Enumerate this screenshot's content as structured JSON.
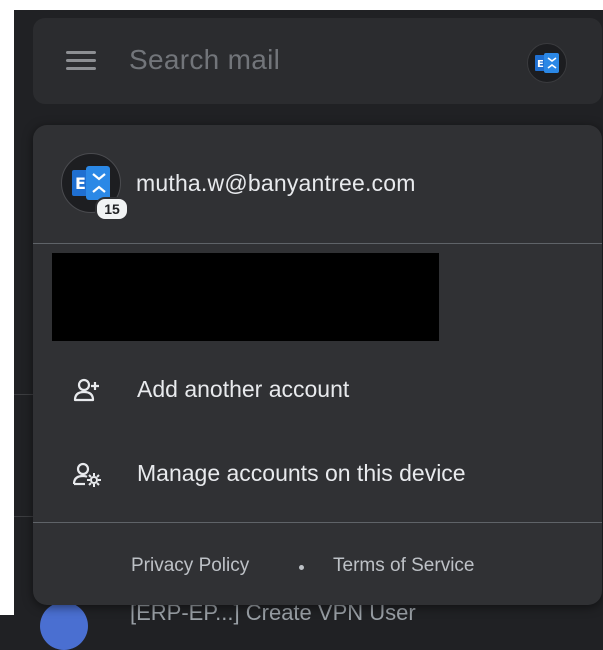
{
  "search": {
    "placeholder": "Search mail"
  },
  "account": {
    "email": "mutha.w@banyantree.com",
    "badge_count": "15",
    "avatar_icon": "exchange-icon"
  },
  "menu": {
    "items": [
      {
        "label": "Add another account",
        "icon": "add-person-icon"
      },
      {
        "label": "Manage accounts on this device",
        "icon": "manage-accounts-icon"
      }
    ]
  },
  "footer": {
    "privacy": "Privacy Policy",
    "separator": "•",
    "terms": "Terms of Service"
  },
  "background": {
    "partial_row_text": "[ERP-EP...] Create VPN User"
  },
  "colors": {
    "exchange_blue": "#1f6fd1",
    "popover_bg": "#303134",
    "page_bg": "#202124"
  }
}
